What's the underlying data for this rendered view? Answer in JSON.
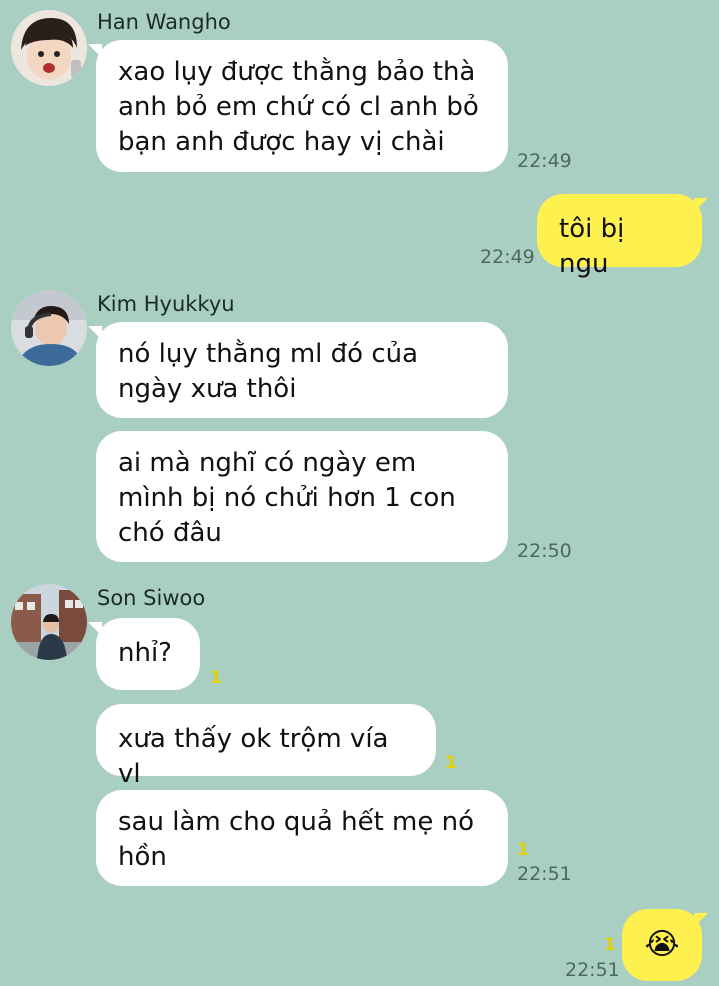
{
  "messages": {
    "group1": {
      "sender": "Han Wangho",
      "bubbles": [
        {
          "text": "xao lụy được thằng bảo thà anh bỏ em chứ có cl anh bỏ bạn anh được hay vị chài"
        }
      ],
      "time": "22:49"
    },
    "outgoing1": {
      "text": "tôi bị ngu",
      "time": "22:49"
    },
    "group2": {
      "sender": "Kim Hyukkyu",
      "bubbles": [
        {
          "text": "nó lụy thằng ml đó của ngày xưa thôi"
        },
        {
          "text": "ai mà nghĩ có ngày em mình bị nó chửi hơn 1 con chó đâu"
        }
      ],
      "time": "22:50"
    },
    "group3": {
      "sender": "Son Siwoo",
      "bubbles": [
        {
          "text": "nhỉ?",
          "unread": "1"
        },
        {
          "text": "xưa thấy ok trộm vía vl",
          "unread": "1"
        },
        {
          "text": "sau làm cho quả hết mẹ nó hồn",
          "unread": "1"
        }
      ],
      "time": "22:51"
    },
    "outgoing2": {
      "text": "😭",
      "time": "22:51",
      "unread": "1"
    }
  },
  "colors": {
    "background": "#a9cfc2",
    "incoming_bubble": "#ffffff",
    "outgoing_bubble": "#fef04e",
    "unread_count": "#e2d000"
  },
  "icons": {
    "avatar1": "profile-photo",
    "avatar2": "profile-photo",
    "avatar3": "profile-photo"
  }
}
